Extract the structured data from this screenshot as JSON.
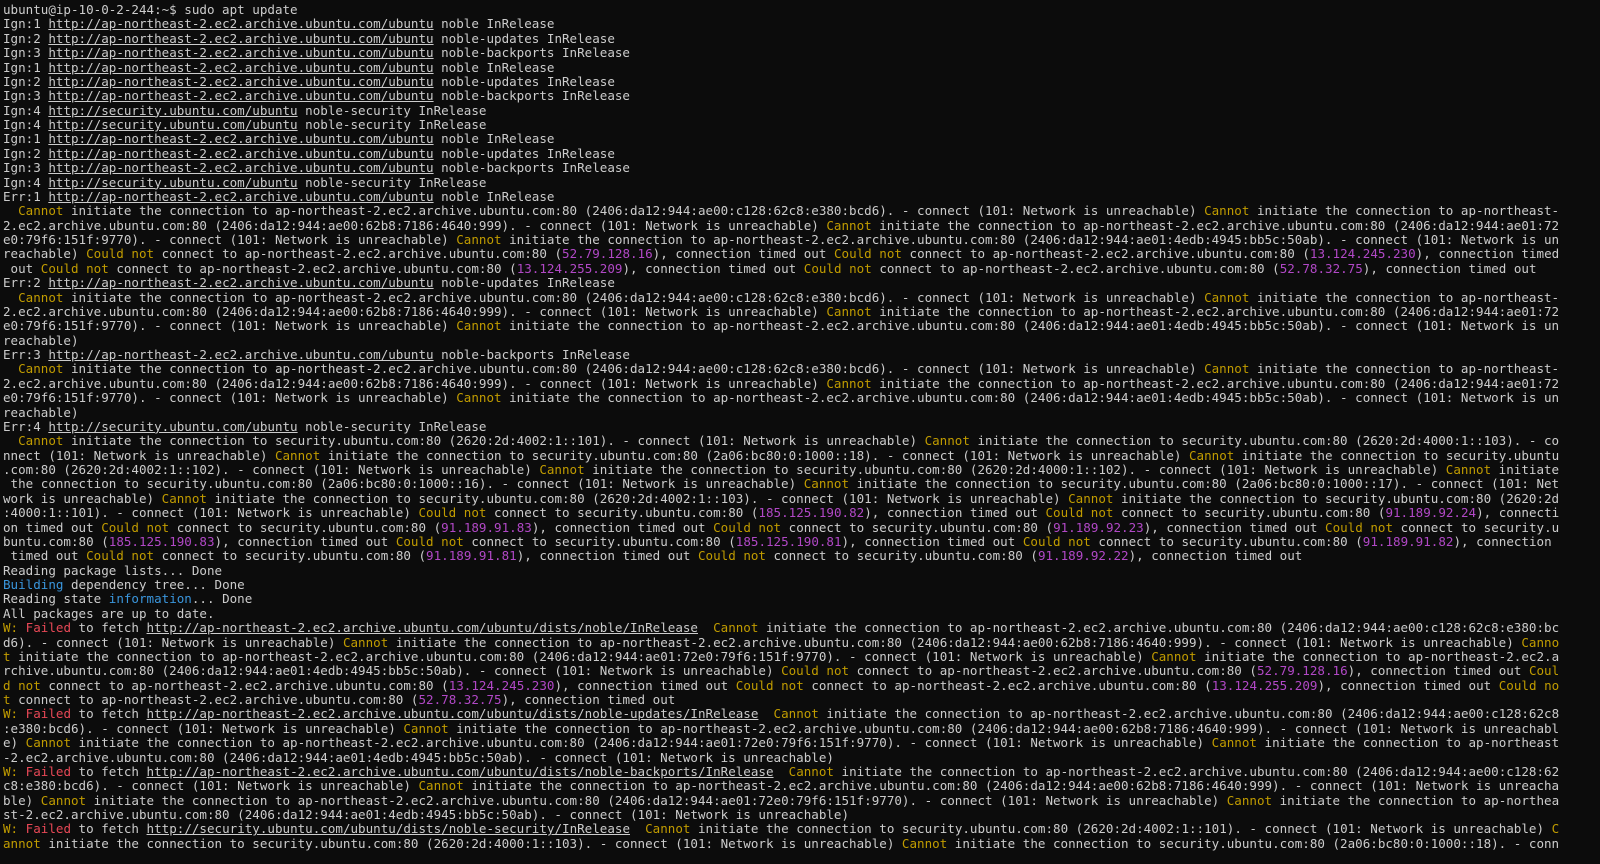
{
  "colors": {
    "text": "#cccccc",
    "background": "#0c0c0c",
    "warn": "#c19c00",
    "ip": "#b148c6",
    "info": "#3a96dd",
    "failed": "#e74856"
  },
  "lines": [
    [
      [
        "",
        "ubuntu@ip-10-0-2-244:~$ sudo apt update"
      ]
    ],
    [
      [
        "",
        "Ign:1 "
      ],
      [
        "u",
        "http://ap-northeast-2.ec2.archive.ubuntu.com/ubuntu"
      ],
      [
        "",
        " noble InRelease"
      ]
    ],
    [
      [
        "",
        "Ign:2 "
      ],
      [
        "u",
        "http://ap-northeast-2.ec2.archive.ubuntu.com/ubuntu"
      ],
      [
        "",
        " noble-updates InRelease"
      ]
    ],
    [
      [
        "",
        "Ign:3 "
      ],
      [
        "u",
        "http://ap-northeast-2.ec2.archive.ubuntu.com/ubuntu"
      ],
      [
        "",
        " noble-backports InRelease"
      ]
    ],
    [
      [
        "",
        "Ign:1 "
      ],
      [
        "u",
        "http://ap-northeast-2.ec2.archive.ubuntu.com/ubuntu"
      ],
      [
        "",
        " noble InRelease"
      ]
    ],
    [
      [
        "",
        "Ign:2 "
      ],
      [
        "u",
        "http://ap-northeast-2.ec2.archive.ubuntu.com/ubuntu"
      ],
      [
        "",
        " noble-updates InRelease"
      ]
    ],
    [
      [
        "",
        "Ign:3 "
      ],
      [
        "u",
        "http://ap-northeast-2.ec2.archive.ubuntu.com/ubuntu"
      ],
      [
        "",
        " noble-backports InRelease"
      ]
    ],
    [
      [
        "",
        "Ign:4 "
      ],
      [
        "u",
        "http://security.ubuntu.com/ubuntu"
      ],
      [
        "",
        " noble-security InRelease"
      ]
    ],
    [
      [
        "",
        "Ign:4 "
      ],
      [
        "u",
        "http://security.ubuntu.com/ubuntu"
      ],
      [
        "",
        " noble-security InRelease"
      ]
    ],
    [
      [
        "",
        "Ign:1 "
      ],
      [
        "u",
        "http://ap-northeast-2.ec2.archive.ubuntu.com/ubuntu"
      ],
      [
        "",
        " noble InRelease"
      ]
    ],
    [
      [
        "",
        "Ign:2 "
      ],
      [
        "u",
        "http://ap-northeast-2.ec2.archive.ubuntu.com/ubuntu"
      ],
      [
        "",
        " noble-updates InRelease"
      ]
    ],
    [
      [
        "",
        "Ign:3 "
      ],
      [
        "u",
        "http://ap-northeast-2.ec2.archive.ubuntu.com/ubuntu"
      ],
      [
        "",
        " noble-backports InRelease"
      ]
    ],
    [
      [
        "",
        "Ign:4 "
      ],
      [
        "u",
        "http://security.ubuntu.com/ubuntu"
      ],
      [
        "",
        " noble-security InRelease"
      ]
    ],
    [
      [
        "",
        "Err:1 "
      ],
      [
        "u",
        "http://ap-northeast-2.ec2.archive.ubuntu.com/ubuntu"
      ],
      [
        "",
        " noble InRelease"
      ]
    ],
    [
      [
        "",
        "  "
      ],
      [
        "y",
        "Cannot"
      ],
      [
        "",
        " initiate the connection to ap-northeast-2.ec2.archive.ubuntu.com:80 (2406:da12:944:ae00:c128:62c8:e380:bcd6). - connect (101: Network is unreachable) "
      ],
      [
        "y",
        "Cannot"
      ],
      [
        "",
        " initiate the connection to ap-northeast-"
      ]
    ],
    [
      [
        "",
        "2.ec2.archive.ubuntu.com:80 (2406:da12:944:ae00:62b8:7186:4640:999). - connect (101: Network is unreachable) "
      ],
      [
        "y",
        "Cannot"
      ],
      [
        "",
        " initiate the connection to ap-northeast-2.ec2.archive.ubuntu.com:80 (2406:da12:944:ae01:72"
      ]
    ],
    [
      [
        "",
        "e0:79f6:151f:9770). - connect (101: Network is unreachable) "
      ],
      [
        "y",
        "Cannot"
      ],
      [
        "",
        " initiate the connection to ap-northeast-2.ec2.archive.ubuntu.com:80 (2406:da12:944:ae01:4edb:4945:bb5c:50ab). - connect (101: Network is un"
      ]
    ],
    [
      [
        "",
        "reachable) "
      ],
      [
        "y",
        "Could not"
      ],
      [
        "",
        " connect to ap-northeast-2.ec2.archive.ubuntu.com:80 ("
      ],
      [
        "m",
        "52.79.128.16"
      ],
      [
        "",
        "), connection timed out "
      ],
      [
        "y",
        "Could not"
      ],
      [
        "",
        " connect to ap-northeast-2.ec2.archive.ubuntu.com:80 ("
      ],
      [
        "m",
        "13.124.245.230"
      ],
      [
        "",
        "), connection timed"
      ]
    ],
    [
      [
        "",
        " out "
      ],
      [
        "y",
        "Could not"
      ],
      [
        "",
        " connect to ap-northeast-2.ec2.archive.ubuntu.com:80 ("
      ],
      [
        "m",
        "13.124.255.209"
      ],
      [
        "",
        "), connection timed out "
      ],
      [
        "y",
        "Could not"
      ],
      [
        "",
        " connect to ap-northeast-2.ec2.archive.ubuntu.com:80 ("
      ],
      [
        "m",
        "52.78.32.75"
      ],
      [
        "",
        "), connection timed out"
      ]
    ],
    [
      [
        "",
        "Err:2 "
      ],
      [
        "u",
        "http://ap-northeast-2.ec2.archive.ubuntu.com/ubuntu"
      ],
      [
        "",
        " noble-updates InRelease"
      ]
    ],
    [
      [
        "",
        "  "
      ],
      [
        "y",
        "Cannot"
      ],
      [
        "",
        " initiate the connection to ap-northeast-2.ec2.archive.ubuntu.com:80 (2406:da12:944:ae00:c128:62c8:e380:bcd6). - connect (101: Network is unreachable) "
      ],
      [
        "y",
        "Cannot"
      ],
      [
        "",
        " initiate the connection to ap-northeast-"
      ]
    ],
    [
      [
        "",
        "2.ec2.archive.ubuntu.com:80 (2406:da12:944:ae00:62b8:7186:4640:999). - connect (101: Network is unreachable) "
      ],
      [
        "y",
        "Cannot"
      ],
      [
        "",
        " initiate the connection to ap-northeast-2.ec2.archive.ubuntu.com:80 (2406:da12:944:ae01:72"
      ]
    ],
    [
      [
        "",
        "e0:79f6:151f:9770). - connect (101: Network is unreachable) "
      ],
      [
        "y",
        "Cannot"
      ],
      [
        "",
        " initiate the connection to ap-northeast-2.ec2.archive.ubuntu.com:80 (2406:da12:944:ae01:4edb:4945:bb5c:50ab). - connect (101: Network is un"
      ]
    ],
    [
      [
        "",
        "reachable)"
      ]
    ],
    [
      [
        "",
        "Err:3 "
      ],
      [
        "u",
        "http://ap-northeast-2.ec2.archive.ubuntu.com/ubuntu"
      ],
      [
        "",
        " noble-backports InRelease"
      ]
    ],
    [
      [
        "",
        "  "
      ],
      [
        "y",
        "Cannot"
      ],
      [
        "",
        " initiate the connection to ap-northeast-2.ec2.archive.ubuntu.com:80 (2406:da12:944:ae00:c128:62c8:e380:bcd6). - connect (101: Network is unreachable) "
      ],
      [
        "y",
        "Cannot"
      ],
      [
        "",
        " initiate the connection to ap-northeast-"
      ]
    ],
    [
      [
        "",
        "2.ec2.archive.ubuntu.com:80 (2406:da12:944:ae00:62b8:7186:4640:999). - connect (101: Network is unreachable) "
      ],
      [
        "y",
        "Cannot"
      ],
      [
        "",
        " initiate the connection to ap-northeast-2.ec2.archive.ubuntu.com:80 (2406:da12:944:ae01:72"
      ]
    ],
    [
      [
        "",
        "e0:79f6:151f:9770). - connect (101: Network is unreachable) "
      ],
      [
        "y",
        "Cannot"
      ],
      [
        "",
        " initiate the connection to ap-northeast-2.ec2.archive.ubuntu.com:80 (2406:da12:944:ae01:4edb:4945:bb5c:50ab). - connect (101: Network is un"
      ]
    ],
    [
      [
        "",
        "reachable)"
      ]
    ],
    [
      [
        "",
        "Err:4 "
      ],
      [
        "u",
        "http://security.ubuntu.com/ubuntu"
      ],
      [
        "",
        " noble-security InRelease"
      ]
    ],
    [
      [
        "",
        "  "
      ],
      [
        "y",
        "Cannot"
      ],
      [
        "",
        " initiate the connection to security.ubuntu.com:80 (2620:2d:4002:1::101). - connect (101: Network is unreachable) "
      ],
      [
        "y",
        "Cannot"
      ],
      [
        "",
        " initiate the connection to security.ubuntu.com:80 (2620:2d:4000:1::103). - co"
      ]
    ],
    [
      [
        "",
        "nnect (101: Network is unreachable) "
      ],
      [
        "y",
        "Cannot"
      ],
      [
        "",
        " initiate the connection to security.ubuntu.com:80 (2a06:bc80:0:1000::18). - connect (101: Network is unreachable) "
      ],
      [
        "y",
        "Cannot"
      ],
      [
        "",
        " initiate the connection to security.ubuntu"
      ]
    ],
    [
      [
        "",
        ".com:80 (2620:2d:4002:1::102). - connect (101: Network is unreachable) "
      ],
      [
        "y",
        "Cannot"
      ],
      [
        "",
        " initiate the connection to security.ubuntu.com:80 (2620:2d:4000:1::102). - connect (101: Network is unreachable) "
      ],
      [
        "y",
        "Cannot"
      ],
      [
        "",
        " initiate"
      ]
    ],
    [
      [
        "",
        " the connection to security.ubuntu.com:80 (2a06:bc80:0:1000::16). - connect (101: Network is unreachable) "
      ],
      [
        "y",
        "Cannot"
      ],
      [
        "",
        " initiate the connection to security.ubuntu.com:80 (2a06:bc80:0:1000::17). - connect (101: Net"
      ]
    ],
    [
      [
        "",
        "work is unreachable) "
      ],
      [
        "y",
        "Cannot"
      ],
      [
        "",
        " initiate the connection to security.ubuntu.com:80 (2620:2d:4002:1::103). - connect (101: Network is unreachable) "
      ],
      [
        "y",
        "Cannot"
      ],
      [
        "",
        " initiate the connection to security.ubuntu.com:80 (2620:2d"
      ]
    ],
    [
      [
        "",
        ":4000:1::101). - connect (101: Network is unreachable) "
      ],
      [
        "y",
        "Could not"
      ],
      [
        "",
        " connect to security.ubuntu.com:80 ("
      ],
      [
        "m",
        "185.125.190.82"
      ],
      [
        "",
        "), connection timed out "
      ],
      [
        "y",
        "Could not"
      ],
      [
        "",
        " connect to security.ubuntu.com:80 ("
      ],
      [
        "m",
        "91.189.92.24"
      ],
      [
        "",
        "), connecti"
      ]
    ],
    [
      [
        "",
        "on timed out "
      ],
      [
        "y",
        "Could not"
      ],
      [
        "",
        " connect to security.ubuntu.com:80 ("
      ],
      [
        "m",
        "91.189.91.83"
      ],
      [
        "",
        "), connection timed out "
      ],
      [
        "y",
        "Could not"
      ],
      [
        "",
        " connect to security.ubuntu.com:80 ("
      ],
      [
        "m",
        "91.189.92.23"
      ],
      [
        "",
        "), connection timed out "
      ],
      [
        "y",
        "Could not"
      ],
      [
        "",
        " connect to security.u"
      ]
    ],
    [
      [
        "",
        "buntu.com:80 ("
      ],
      [
        "m",
        "185.125.190.83"
      ],
      [
        "",
        "), connection timed out "
      ],
      [
        "y",
        "Could not"
      ],
      [
        "",
        " connect to security.ubuntu.com:80 ("
      ],
      [
        "m",
        "185.125.190.81"
      ],
      [
        "",
        "), connection timed out "
      ],
      [
        "y",
        "Could not"
      ],
      [
        "",
        " connect to security.ubuntu.com:80 ("
      ],
      [
        "m",
        "91.189.91.82"
      ],
      [
        "",
        "), connection"
      ]
    ],
    [
      [
        "",
        " timed out "
      ],
      [
        "y",
        "Could not"
      ],
      [
        "",
        " connect to security.ubuntu.com:80 ("
      ],
      [
        "m",
        "91.189.91.81"
      ],
      [
        "",
        "), connection timed out "
      ],
      [
        "y",
        "Could not"
      ],
      [
        "",
        " connect to security.ubuntu.com:80 ("
      ],
      [
        "m",
        "91.189.92.22"
      ],
      [
        "",
        "), connection timed out"
      ]
    ],
    [
      [
        "",
        "Reading package lists... Done"
      ]
    ],
    [
      [
        "c",
        "Building"
      ],
      [
        "",
        " dependency tree... Done"
      ]
    ],
    [
      [
        "",
        "Reading state "
      ],
      [
        "c",
        "information"
      ],
      [
        "",
        "... Done"
      ]
    ],
    [
      [
        "",
        "All packages are up to date."
      ]
    ],
    [
      [
        "y",
        "W: "
      ],
      [
        "r",
        "Failed"
      ],
      [
        "",
        " to fetch "
      ],
      [
        "u",
        "http://ap-northeast-2.ec2.archive.ubuntu.com/ubuntu/dists/noble/InRelease"
      ],
      [
        "",
        "  "
      ],
      [
        "y",
        "Cannot"
      ],
      [
        "",
        " initiate the connection to ap-northeast-2.ec2.archive.ubuntu.com:80 (2406:da12:944:ae00:c128:62c8:e380:bc"
      ]
    ],
    [
      [
        "",
        "d6). - connect (101: Network is unreachable) "
      ],
      [
        "y",
        "Cannot"
      ],
      [
        "",
        " initiate the connection to ap-northeast-2.ec2.archive.ubuntu.com:80 (2406:da12:944:ae00:62b8:7186:4640:999). - connect (101: Network is unreachable) "
      ],
      [
        "y",
        "Canno"
      ]
    ],
    [
      [
        "y",
        "t"
      ],
      [
        "",
        " initiate the connection to ap-northeast-2.ec2.archive.ubuntu.com:80 (2406:da12:944:ae01:72e0:79f6:151f:9770). - connect (101: Network is unreachable) "
      ],
      [
        "y",
        "Cannot"
      ],
      [
        "",
        " initiate the connection to ap-northeast-2.ec2.a"
      ]
    ],
    [
      [
        "",
        "rchive.ubuntu.com:80 (2406:da12:944:ae01:4edb:4945:bb5c:50ab). - connect (101: Network is unreachable) "
      ],
      [
        "y",
        "Could not"
      ],
      [
        "",
        " connect to ap-northeast-2.ec2.archive.ubuntu.com:80 ("
      ],
      [
        "m",
        "52.79.128.16"
      ],
      [
        "",
        "), connection timed out "
      ],
      [
        "y",
        "Coul"
      ]
    ],
    [
      [
        "y",
        "d not"
      ],
      [
        "",
        " connect to ap-northeast-2.ec2.archive.ubuntu.com:80 ("
      ],
      [
        "m",
        "13.124.245.230"
      ],
      [
        "",
        "), connection timed out "
      ],
      [
        "y",
        "Could not"
      ],
      [
        "",
        " connect to ap-northeast-2.ec2.archive.ubuntu.com:80 ("
      ],
      [
        "m",
        "13.124.255.209"
      ],
      [
        "",
        "), connection timed out "
      ],
      [
        "y",
        "Could no"
      ]
    ],
    [
      [
        "y",
        "t"
      ],
      [
        "",
        " connect to ap-northeast-2.ec2.archive.ubuntu.com:80 ("
      ],
      [
        "m",
        "52.78.32.75"
      ],
      [
        "",
        "), connection timed out"
      ]
    ],
    [
      [
        "y",
        "W: "
      ],
      [
        "r",
        "Failed"
      ],
      [
        "",
        " to fetch "
      ],
      [
        "u",
        "http://ap-northeast-2.ec2.archive.ubuntu.com/ubuntu/dists/noble-updates/InRelease"
      ],
      [
        "",
        "  "
      ],
      [
        "y",
        "Cannot"
      ],
      [
        "",
        " initiate the connection to ap-northeast-2.ec2.archive.ubuntu.com:80 (2406:da12:944:ae00:c128:62c8"
      ]
    ],
    [
      [
        "",
        ":e380:bcd6). - connect (101: Network is unreachable) "
      ],
      [
        "y",
        "Cannot"
      ],
      [
        "",
        " initiate the connection to ap-northeast-2.ec2.archive.ubuntu.com:80 (2406:da12:944:ae00:62b8:7186:4640:999). - connect (101: Network is unreachabl"
      ]
    ],
    [
      [
        "",
        "e) "
      ],
      [
        "y",
        "Cannot"
      ],
      [
        "",
        " initiate the connection to ap-northeast-2.ec2.archive.ubuntu.com:80 (2406:da12:944:ae01:72e0:79f6:151f:9770). - connect (101: Network is unreachable) "
      ],
      [
        "y",
        "Cannot"
      ],
      [
        "",
        " initiate the connection to ap-northeast"
      ]
    ],
    [
      [
        "",
        "-2.ec2.archive.ubuntu.com:80 (2406:da12:944:ae01:4edb:4945:bb5c:50ab). - connect (101: Network is unreachable)"
      ]
    ],
    [
      [
        "y",
        "W: "
      ],
      [
        "r",
        "Failed"
      ],
      [
        "",
        " to fetch "
      ],
      [
        "u",
        "http://ap-northeast-2.ec2.archive.ubuntu.com/ubuntu/dists/noble-backports/InRelease"
      ],
      [
        "",
        "  "
      ],
      [
        "y",
        "Cannot"
      ],
      [
        "",
        " initiate the connection to ap-northeast-2.ec2.archive.ubuntu.com:80 (2406:da12:944:ae00:c128:62"
      ]
    ],
    [
      [
        "",
        "c8:e380:bcd6). - connect (101: Network is unreachable) "
      ],
      [
        "y",
        "Cannot"
      ],
      [
        "",
        " initiate the connection to ap-northeast-2.ec2.archive.ubuntu.com:80 (2406:da12:944:ae00:62b8:7186:4640:999). - connect (101: Network is unreacha"
      ]
    ],
    [
      [
        "",
        "ble) "
      ],
      [
        "y",
        "Cannot"
      ],
      [
        "",
        " initiate the connection to ap-northeast-2.ec2.archive.ubuntu.com:80 (2406:da12:944:ae01:72e0:79f6:151f:9770). - connect (101: Network is unreachable) "
      ],
      [
        "y",
        "Cannot"
      ],
      [
        "",
        " initiate the connection to ap-northea"
      ]
    ],
    [
      [
        "",
        "st-2.ec2.archive.ubuntu.com:80 (2406:da12:944:ae01:4edb:4945:bb5c:50ab). - connect (101: Network is unreachable)"
      ]
    ],
    [
      [
        "y",
        "W: "
      ],
      [
        "r",
        "Failed"
      ],
      [
        "",
        " to fetch "
      ],
      [
        "u",
        "http://security.ubuntu.com/ubuntu/dists/noble-security/InRelease"
      ],
      [
        "",
        "  "
      ],
      [
        "y",
        "Cannot"
      ],
      [
        "",
        " initiate the connection to security.ubuntu.com:80 (2620:2d:4002:1::101). - connect (101: Network is unreachable) "
      ],
      [
        "y",
        "C"
      ]
    ],
    [
      [
        "y",
        "annot"
      ],
      [
        "",
        " initiate the connection to security.ubuntu.com:80 (2620:2d:4000:1::103). - connect (101: Network is unreachable) "
      ],
      [
        "y",
        "Cannot"
      ],
      [
        "",
        " initiate the connection to security.ubuntu.com:80 (2a06:bc80:0:1000::18). - conn"
      ]
    ]
  ]
}
